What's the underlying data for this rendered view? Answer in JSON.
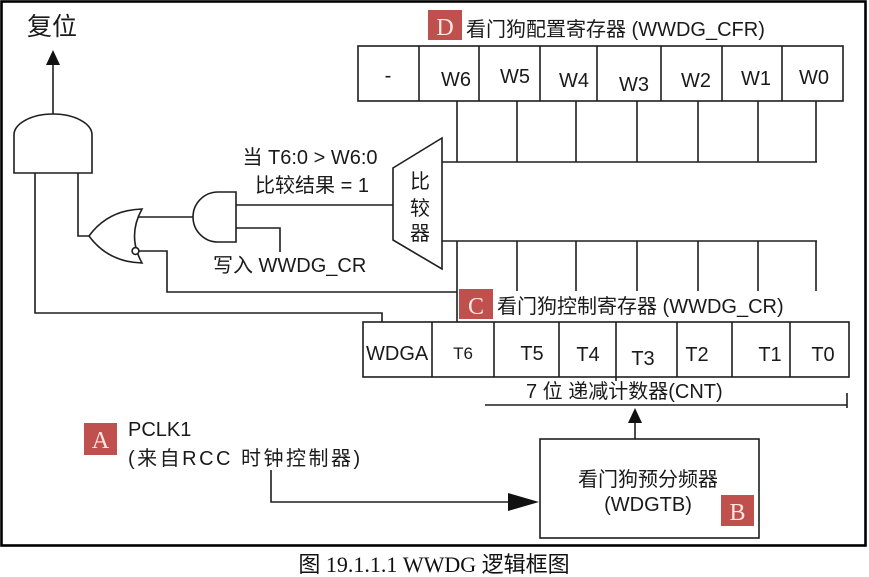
{
  "figure": {
    "caption": "图 19.1.1.1 WWDG 逻辑框图",
    "reset_label": "复位",
    "comparator": {
      "chars": [
        "比",
        "较",
        "器"
      ],
      "condition_line1": "当 T6:0 > W6:0",
      "condition_line2": "比较结果 = 1"
    },
    "write_label": "写入 WWDG_CR",
    "cfr_register": {
      "badge": "D",
      "title": "看门狗配置寄存器 (WWDG_CFR)",
      "bits": [
        "-",
        "W6",
        "W5",
        "W4",
        "W3",
        "W2",
        "W1",
        "W0"
      ]
    },
    "cr_register": {
      "badge": "C",
      "title": "看门狗控制寄存器 (WWDG_CR)",
      "bits": [
        "WDGA",
        "T6",
        "T5",
        "T4",
        "T3",
        "T2",
        "T1",
        "T0"
      ]
    },
    "counter_label": "7 位 递减计数器(CNT)",
    "clock": {
      "badge": "A",
      "name": "PCLK1",
      "source": "(来自RCC 时钟控制器)"
    },
    "prescaler": {
      "badge": "B",
      "name": "看门狗预分频器",
      "code": "(WDGTB)"
    }
  },
  "colors": {
    "badge_fill": "#c0504d",
    "badge_text": "#fbe9e2"
  }
}
